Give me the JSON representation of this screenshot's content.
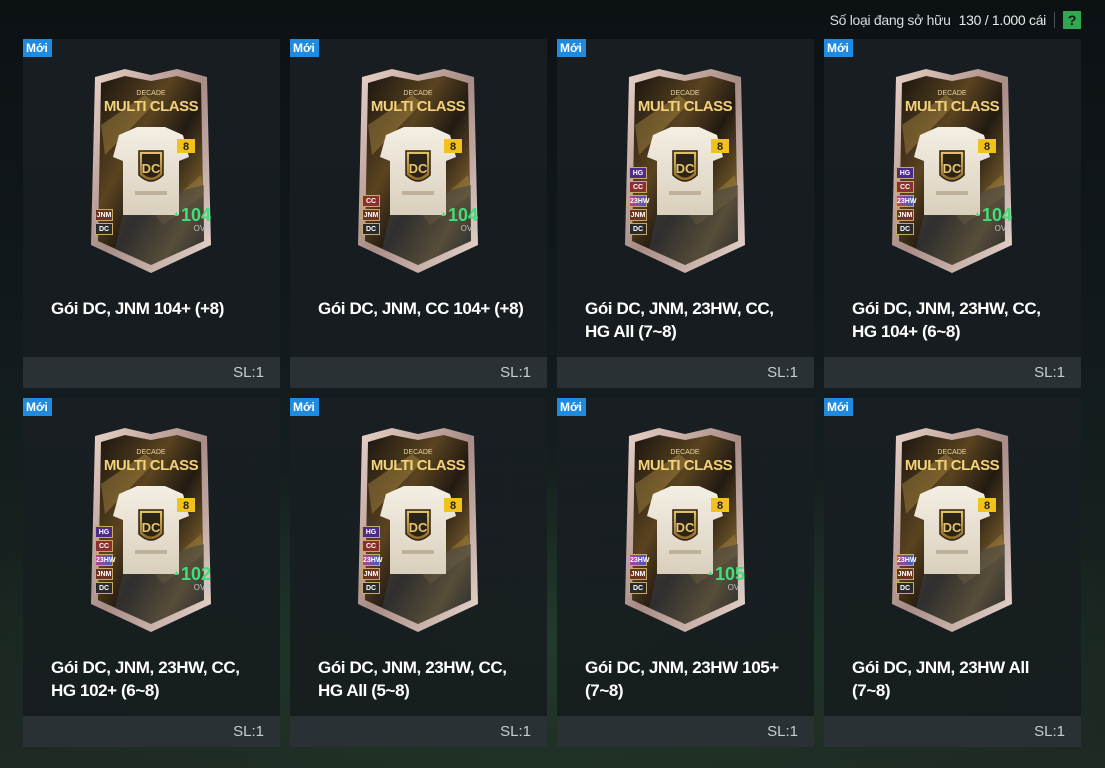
{
  "header": {
    "owned_label": "Số loại đang sở hữu",
    "owned_count": "130 / 1.000 cái",
    "help_icon": "?"
  },
  "card_art": {
    "top_label": "DECADE",
    "title": "MULTI CLASS",
    "crest": "DC",
    "upgrade": "8",
    "ovr_label": "OVR"
  },
  "packs": [
    {
      "badge": "Mới",
      "title": "Gói DC, JNM 104+ (+8)",
      "qty": "SL:1",
      "ovr": "104",
      "classes": [
        "JNM",
        "DC"
      ]
    },
    {
      "badge": "Mới",
      "title": "Gói DC, JNM, CC 104+ (+8)",
      "qty": "SL:1",
      "ovr": "104",
      "classes": [
        "CC",
        "JNM",
        "DC"
      ]
    },
    {
      "badge": "Mới",
      "title": "Gói DC, JNM, 23HW, CC, HG All (7~8)",
      "qty": "SL:1",
      "ovr": "",
      "classes": [
        "HG",
        "CC",
        "23HW",
        "JNM",
        "DC"
      ]
    },
    {
      "badge": "Mới",
      "title": "Gói DC, JNM, 23HW, CC, HG 104+ (6~8)",
      "qty": "SL:1",
      "ovr": "104",
      "classes": [
        "HG",
        "CC",
        "23HW",
        "JNM",
        "DC"
      ]
    },
    {
      "badge": "Mới",
      "title": "Gói DC, JNM, 23HW, CC, HG 102+ (6~8)",
      "qty": "SL:1",
      "ovr": "102",
      "classes": [
        "HG",
        "CC",
        "23HW",
        "JNM",
        "DC"
      ]
    },
    {
      "badge": "Mới",
      "title": "Gói DC, JNM, 23HW, CC, HG All (5~8)",
      "qty": "SL:1",
      "ovr": "",
      "classes": [
        "HG",
        "CC",
        "23HW",
        "JNM",
        "DC"
      ]
    },
    {
      "badge": "Mới",
      "title": "Gói DC, JNM, 23HW 105+ (7~8)",
      "qty": "SL:1",
      "ovr": "105",
      "classes": [
        "23HW",
        "JNM",
        "DC"
      ]
    },
    {
      "badge": "Mới",
      "title": "Gói DC, JNM, 23HW All (7~8)",
      "qty": "SL:1",
      "ovr": "",
      "classes": [
        "23HW",
        "JNM",
        "DC"
      ]
    }
  ],
  "colors": {
    "new_badge": "#1f8be0",
    "ovr_green": "#3fe07a",
    "help_green": "#2fa84f",
    "gold": "#e2b54a"
  }
}
